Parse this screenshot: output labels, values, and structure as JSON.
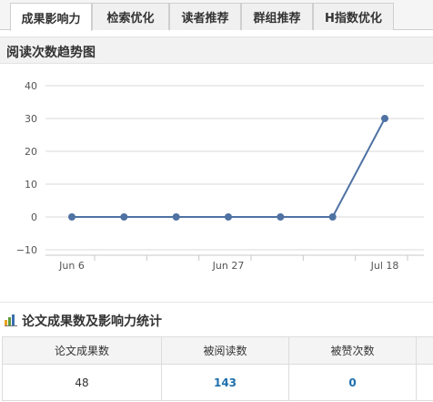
{
  "tabs": [
    {
      "label": "成果影响力",
      "active": true
    },
    {
      "label": "检索优化",
      "active": false
    },
    {
      "label": "读者推荐",
      "active": false
    },
    {
      "label": "群组推荐",
      "active": false
    },
    {
      "label": "H指数优化",
      "active": false
    }
  ],
  "chart_section": {
    "title": "阅读次数趋势图"
  },
  "chart_data": {
    "type": "line",
    "x": [
      "Jun 6",
      "Jun 13",
      "Jun 20",
      "Jun 27",
      "Jul 4",
      "Jul 11",
      "Jul 18"
    ],
    "x_tick_labels": [
      "Jun 6",
      "Jun 27",
      "Jul 18"
    ],
    "y": [
      0,
      0,
      0,
      0,
      0,
      0,
      30
    ],
    "ylim": [
      -10,
      40
    ],
    "y_ticks": [
      -10,
      0,
      10,
      20,
      30,
      40
    ],
    "grid": true,
    "line_color": "#4f72a3"
  },
  "stats": {
    "title": "论文成果数及影响力统计",
    "icon": "bar-chart-icon",
    "headers": [
      "论文成果数",
      "被阅读数",
      "被赞次数",
      ""
    ],
    "values": [
      "48",
      "143",
      "0",
      ""
    ]
  }
}
